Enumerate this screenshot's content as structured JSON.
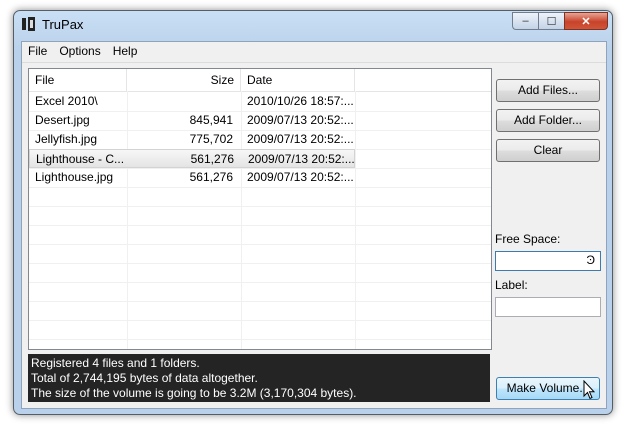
{
  "window": {
    "title": "TruPax",
    "controls": {
      "minimize": "‒",
      "maximize": "☐",
      "close": "✕"
    }
  },
  "menu": [
    "File",
    "Options",
    "Help"
  ],
  "list": {
    "columns": [
      "File",
      "Size",
      "Date"
    ],
    "rows": [
      {
        "file": "Excel 2010\\",
        "size": "",
        "date": "2010/10/26 18:57:...",
        "selected": false
      },
      {
        "file": "Desert.jpg",
        "size": "845,941",
        "date": "2009/07/13 20:52:...",
        "selected": false
      },
      {
        "file": "Jellyfish.jpg",
        "size": "775,702",
        "date": "2009/07/13 20:52:...",
        "selected": false
      },
      {
        "file": "Lighthouse - C...",
        "size": "561,276",
        "date": "2009/07/13 20:52:...",
        "selected": true
      },
      {
        "file": "Lighthouse.jpg",
        "size": "561,276",
        "date": "2009/07/13 20:52:...",
        "selected": false
      }
    ]
  },
  "buttons": {
    "add_files": "Add Files...",
    "add_folder": "Add Folder...",
    "clear": "Clear",
    "make_volume": "Make Volume..."
  },
  "free_space": {
    "label": "Free Space:",
    "value": "",
    "glyph": "Ͽ"
  },
  "volume_label": {
    "label": "Label:",
    "value": ""
  },
  "status": [
    "Registered 4 files and 1 folders.",
    "Total of 2,744,195 bytes of data altogether.",
    "The size of the volume is going to be 3.2M (3,170,304 bytes)."
  ]
}
